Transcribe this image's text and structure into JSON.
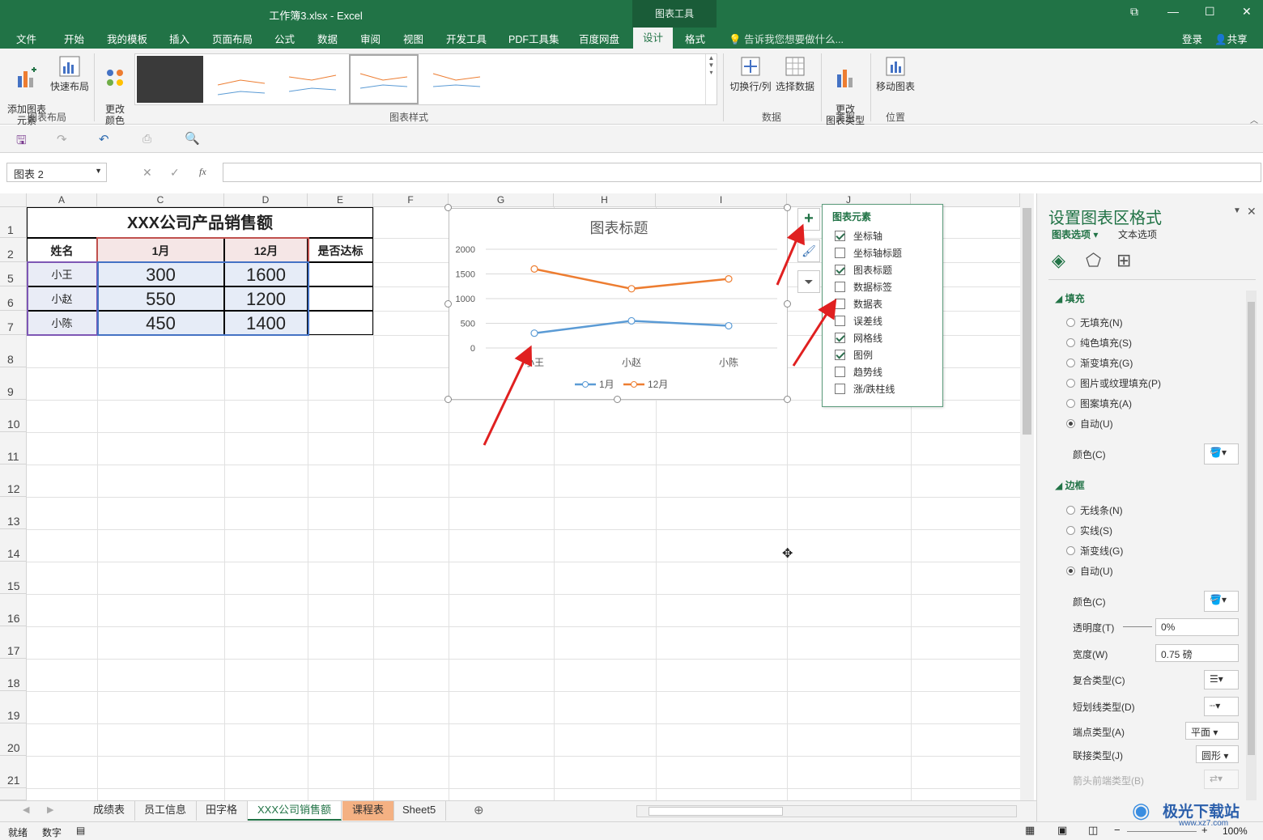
{
  "window": {
    "title": "工作簿3.xlsx - Excel",
    "context_tab": "图表工具"
  },
  "menu": {
    "items": [
      "文件",
      "开始",
      "我的模板",
      "插入",
      "页面布局",
      "公式",
      "数据",
      "审阅",
      "视图",
      "开发工具",
      "PDF工具集",
      "百度网盘",
      "设计",
      "格式"
    ],
    "active": "设计",
    "tell_me": "告诉我您想要做什么...",
    "login": "登录",
    "share": "共享"
  },
  "ribbon": {
    "add_element": "添加图表\n元素",
    "quick_layout": "快速布局",
    "change_color": "更改\n颜色",
    "group_layout": "图表布局",
    "group_styles": "图表样式",
    "switch_rowcol": "切换行/列",
    "select_data": "选择数据",
    "group_data": "数据",
    "change_type": "更改\n图表类型",
    "group_type": "类型",
    "move_chart": "移动图表",
    "group_location": "位置"
  },
  "namebox": "图表 2",
  "sheet": {
    "columns": [
      "A",
      "C",
      "D",
      "E",
      "F",
      "G",
      "H",
      "I",
      "J"
    ],
    "rows": [
      "1",
      "2",
      "5",
      "6",
      "7",
      "8",
      "9",
      "10",
      "11",
      "12",
      "13",
      "14",
      "15",
      "16",
      "17",
      "18",
      "19",
      "20",
      "21"
    ],
    "table_title": "XXX公司产品销售额",
    "headers": [
      "姓名",
      "1月",
      "12月",
      "是否达标"
    ],
    "data": [
      [
        "小王",
        "300",
        "1600"
      ],
      [
        "小赵",
        "550",
        "1200"
      ],
      [
        "小陈",
        "450",
        "1400"
      ]
    ]
  },
  "chart_data": {
    "type": "line",
    "title": "图表标题",
    "categories": [
      "小王",
      "小赵",
      "小陈"
    ],
    "series": [
      {
        "name": "1月",
        "values": [
          300,
          550,
          450
        ],
        "color": "#5b9bd5"
      },
      {
        "name": "12月",
        "values": [
          1600,
          1200,
          1400
        ],
        "color": "#ed7d31"
      }
    ],
    "yticks": [
      "0",
      "500",
      "1000",
      "1500",
      "2000"
    ],
    "ylim": [
      0,
      2000
    ],
    "grid": true,
    "legend": "bottom"
  },
  "chart_elements": {
    "title": "图表元素",
    "items": [
      {
        "label": "坐标轴",
        "checked": true
      },
      {
        "label": "坐标轴标题",
        "checked": false
      },
      {
        "label": "图表标题",
        "checked": true
      },
      {
        "label": "数据标签",
        "checked": false
      },
      {
        "label": "数据表",
        "checked": false
      },
      {
        "label": "误差线",
        "checked": false
      },
      {
        "label": "网格线",
        "checked": true
      },
      {
        "label": "图例",
        "checked": true
      },
      {
        "label": "趋势线",
        "checked": false
      },
      {
        "label": "涨/跌柱线",
        "checked": false
      }
    ]
  },
  "pane": {
    "title": "设置图表区格式",
    "tab_chart": "图表选项",
    "tab_text": "文本选项",
    "fill": "填充",
    "fill_opts": [
      "无填充(N)",
      "纯色填充(S)",
      "渐变填充(G)",
      "图片或纹理填充(P)",
      "图案填充(A)",
      "自动(U)"
    ],
    "color": "颜色(C)",
    "border": "边框",
    "border_opts": [
      "无线条(N)",
      "实线(S)",
      "渐变线(G)",
      "自动(U)"
    ],
    "transparency": "透明度(T)",
    "transparency_val": "0%",
    "width": "宽度(W)",
    "width_val": "0.75 磅",
    "compound": "复合类型(C)",
    "dash": "短划线类型(D)",
    "cap": "端点类型(A)",
    "cap_val": "平面",
    "join": "联接类型(J)",
    "join_val": "圆形",
    "arrow_begin": "箭头前端类型(B)"
  },
  "tabs": [
    "成绩表",
    "员工信息",
    "田字格",
    "XXX公司销售额",
    "课程表",
    "Sheet5"
  ],
  "active_tab": "XXX公司销售额",
  "status": {
    "ready": "就绪",
    "num": "数字",
    "zoom": "100%"
  },
  "watermark": "极光下载站",
  "watermark_url": "www.xz7.com"
}
